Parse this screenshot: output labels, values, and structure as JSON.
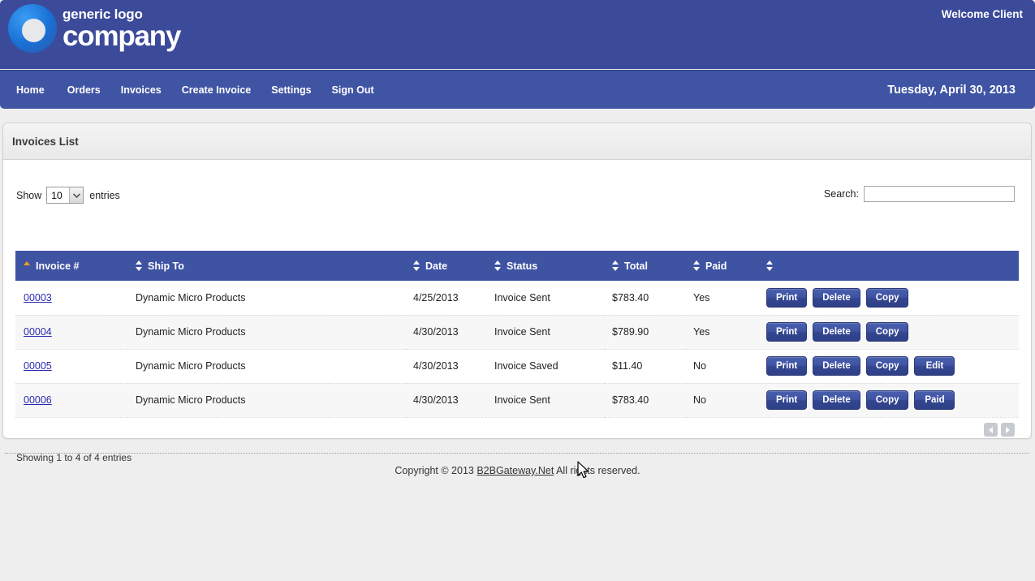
{
  "header": {
    "logo_line1": "generic logo",
    "logo_line2": "company",
    "welcome": "Welcome Client",
    "brand_color": "#3b4a99",
    "nav_color": "#4054a4"
  },
  "nav": {
    "items": [
      {
        "label": "Home"
      },
      {
        "label": "Orders"
      },
      {
        "label": "Invoices"
      },
      {
        "label": "Create Invoice"
      },
      {
        "label": "Settings"
      },
      {
        "label": "Sign Out"
      }
    ],
    "date": "Tuesday, April 30, 2013"
  },
  "panel": {
    "title": "Invoices List"
  },
  "controls": {
    "show_label": "Show",
    "page_length": "10",
    "entries_label": "entries",
    "search_label": "Search:",
    "search_value": "",
    "search_placeholder": ""
  },
  "table": {
    "columns": [
      {
        "label": "Invoice #",
        "sort": "asc"
      },
      {
        "label": "Ship To",
        "sort": "none"
      },
      {
        "label": "Date",
        "sort": "none"
      },
      {
        "label": "Status",
        "sort": "none"
      },
      {
        "label": "Total",
        "sort": "none"
      },
      {
        "label": "Paid",
        "sort": "none"
      },
      {
        "label": "",
        "sort": "none"
      }
    ],
    "rows": [
      {
        "invoice": "00003",
        "ship_to": "Dynamic Micro Products",
        "date": "4/25/2013",
        "status": "Invoice Sent",
        "total": "$783.40",
        "paid": "Yes",
        "actions": [
          "Print",
          "Delete",
          "Copy"
        ]
      },
      {
        "invoice": "00004",
        "ship_to": "Dynamic Micro Products",
        "date": "4/30/2013",
        "status": "Invoice Sent",
        "total": "$789.90",
        "paid": "Yes",
        "actions": [
          "Print",
          "Delete",
          "Copy"
        ]
      },
      {
        "invoice": "00005",
        "ship_to": "Dynamic Micro Products",
        "date": "4/30/2013",
        "status": "Invoice Saved",
        "total": "$11.40",
        "paid": "No",
        "actions": [
          "Print",
          "Delete",
          "Copy",
          "Edit"
        ]
      },
      {
        "invoice": "00006",
        "ship_to": "Dynamic Micro Products",
        "date": "4/30/2013",
        "status": "Invoice Sent",
        "total": "$783.40",
        "paid": "No",
        "actions": [
          "Print",
          "Delete",
          "Copy",
          "Paid"
        ]
      }
    ],
    "info": "Showing 1 to 4 of 4 entries",
    "pager": {
      "prev_icon": "triangle-left-icon",
      "next_icon": "triangle-right-icon"
    }
  },
  "footer": {
    "copyright_prefix": "Copyright © 2013 ",
    "link_text": "B2BGateway.Net",
    "copyright_suffix": " All rights reserved."
  }
}
